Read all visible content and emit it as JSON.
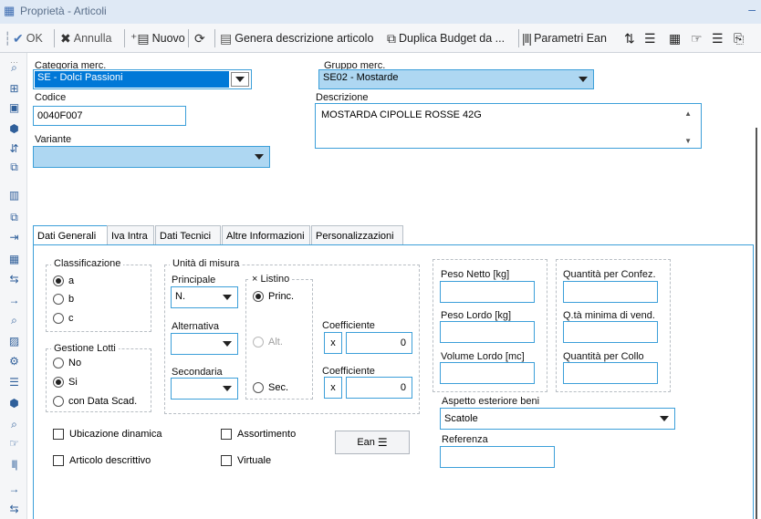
{
  "window": {
    "title": "Proprietà - Articoli"
  },
  "toolbar": {
    "ok": "OK",
    "annulla": "Annulla",
    "nuovo": "Nuovo",
    "genera": "Genera descrizione articolo",
    "duplica": "Duplica Budget da ...",
    "parametri": "Parametri Ean"
  },
  "header": {
    "categoria_label": "Categoria merc.",
    "categoria_value": "SE - Dolci Passioni",
    "gruppo_label": "Gruppo merc.",
    "gruppo_value": "SE02 - Mostarde",
    "codice_label": "Codice",
    "codice_value": "0040F007",
    "descrizione_label": "Descrizione",
    "descrizione_value": "MOSTARDA CIPOLLE ROSSE 42G",
    "variante_label": "Variante",
    "variante_value": ""
  },
  "tabs": [
    "Dati Generali",
    "Iva Intra",
    "Dati Tecnici",
    "Altre Informazioni",
    "Personalizzazioni"
  ],
  "classificazione": {
    "title": "Classificazione",
    "options": [
      "a",
      "b",
      "c"
    ],
    "selected": "a"
  },
  "gestione_lotti": {
    "title": "Gestione Lotti",
    "options": [
      "No",
      "Si",
      "con Data Scad."
    ],
    "selected": "Si"
  },
  "unita": {
    "title": "Unità di misura",
    "principale_label": "Principale",
    "principale_value": "N.",
    "alternativa_label": "Alternativa",
    "alternativa_value": "",
    "secondaria_label": "Secondaria",
    "secondaria_value": "",
    "listino_title": "Listino",
    "listino_options": [
      "Princ.",
      "Alt.",
      "Sec."
    ],
    "listino_selected": "Princ.",
    "coefficiente_label": "Coefficiente",
    "coeff_x": "x",
    "coeff_alt_value": "0",
    "coeff_sec_value": "0"
  },
  "checks": {
    "ubicazione": "Ubicazione dinamica",
    "articolo_descrittivo": "Articolo descrittivo",
    "assortimento": "Assortimento",
    "virtuale": "Virtuale"
  },
  "ean_button": "Ean",
  "pesi": {
    "peso_netto": "Peso Netto [kg]",
    "peso_lordo": "Peso Lordo [kg]",
    "volume_lordo": "Volume Lordo [mc]"
  },
  "quantita": {
    "per_confez": "Quantità per Confez.",
    "minima_vend": "Q.tà minima di vend.",
    "per_collo": "Quantità per Collo"
  },
  "aspetto": {
    "label": "Aspetto esteriore beni",
    "value": "Scatole"
  },
  "referenza": {
    "label": "Referenza",
    "value": ""
  },
  "colors": {
    "accent": "#3c9fd9",
    "selection": "#0078d7",
    "field_blue": "#aed7f2"
  }
}
